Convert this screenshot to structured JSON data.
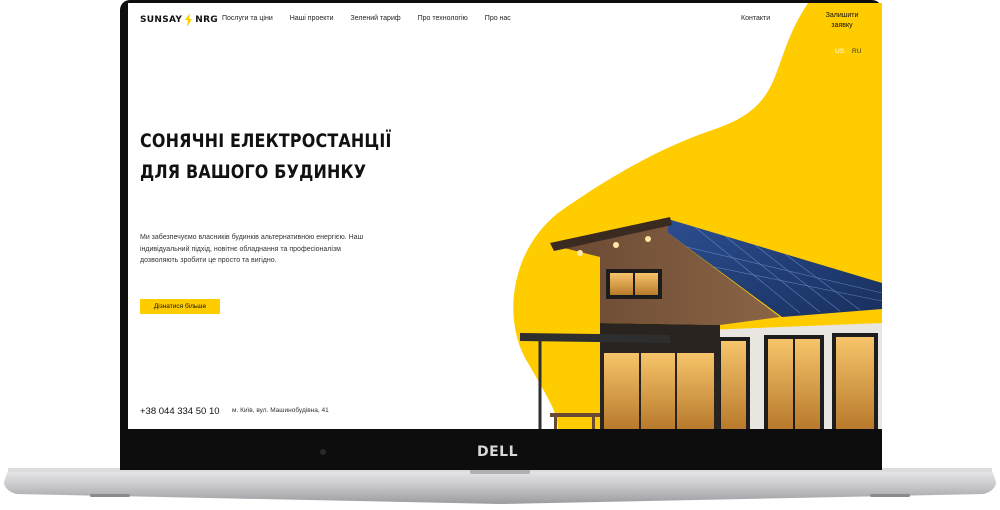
{
  "brand": {
    "logo_left": "SUNSAY",
    "logo_right": "NRG",
    "accent_color": "#ffcc00",
    "laptop_brand": "DELL"
  },
  "nav": {
    "items": [
      "Послуги та ціни",
      "Наші проекти",
      "Зелений тариф",
      "Про технологію",
      "Про нас"
    ],
    "contacts": "Контакти",
    "cta_line1": "Залишити",
    "cta_line2": "заявку"
  },
  "lang": {
    "us": "US",
    "ru": "RU"
  },
  "hero": {
    "title_line1": "СОНЯЧНІ ЕЛЕКТРОСТАНЦІЇ",
    "title_line2": "ДЛЯ ВАШОГО БУДИНКУ",
    "text": "Ми забезпечуємо власників будинків альтернативною енергією. Наш індивідуальний підхід, новітнє обладнання та професіоналізм дозволяють зробити це просто та вигідно.",
    "button": "Дізнатися більше"
  },
  "footer": {
    "phone": "+38 044 334 50 10",
    "address": "м. Київ, вул. Машинобудівна, 41"
  },
  "icons": {
    "logo_mark": "lightning-s-icon",
    "house_image": "modern-house-with-solar-panels"
  }
}
